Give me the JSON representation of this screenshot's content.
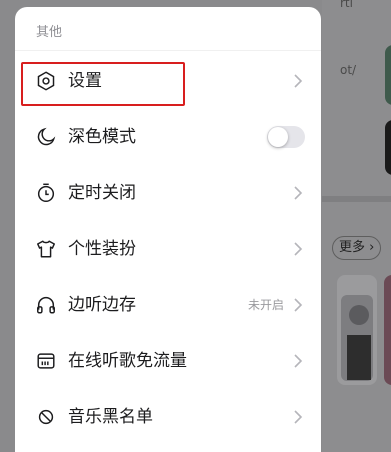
{
  "colors": {
    "highlight": "#d81e1e",
    "panel": "#ffffff",
    "text": "#1c1c1e",
    "muted": "#8e8e93"
  },
  "background": {
    "fragments": [
      "rti",
      "ot/",
      "更多"
    ]
  },
  "drawer": {
    "section_title": "其他",
    "items": [
      {
        "label": "设置",
        "icon": "settings-hexagon-icon",
        "trailing": "chevron",
        "highlighted": true
      },
      {
        "label": "深色模式",
        "icon": "moon-icon",
        "trailing": "toggle",
        "toggle_on": false
      },
      {
        "label": "定时关闭",
        "icon": "timer-icon",
        "trailing": "chevron"
      },
      {
        "label": "个性装扮",
        "icon": "tshirt-icon",
        "trailing": "chevron"
      },
      {
        "label": "边听边存",
        "icon": "headphones-icon",
        "trailing": "chevron",
        "status": "未开启"
      },
      {
        "label": "在线听歌免流量",
        "icon": "sim-card-icon",
        "trailing": "chevron"
      },
      {
        "label": "音乐黑名单",
        "icon": "block-icon",
        "trailing": "chevron"
      }
    ]
  }
}
